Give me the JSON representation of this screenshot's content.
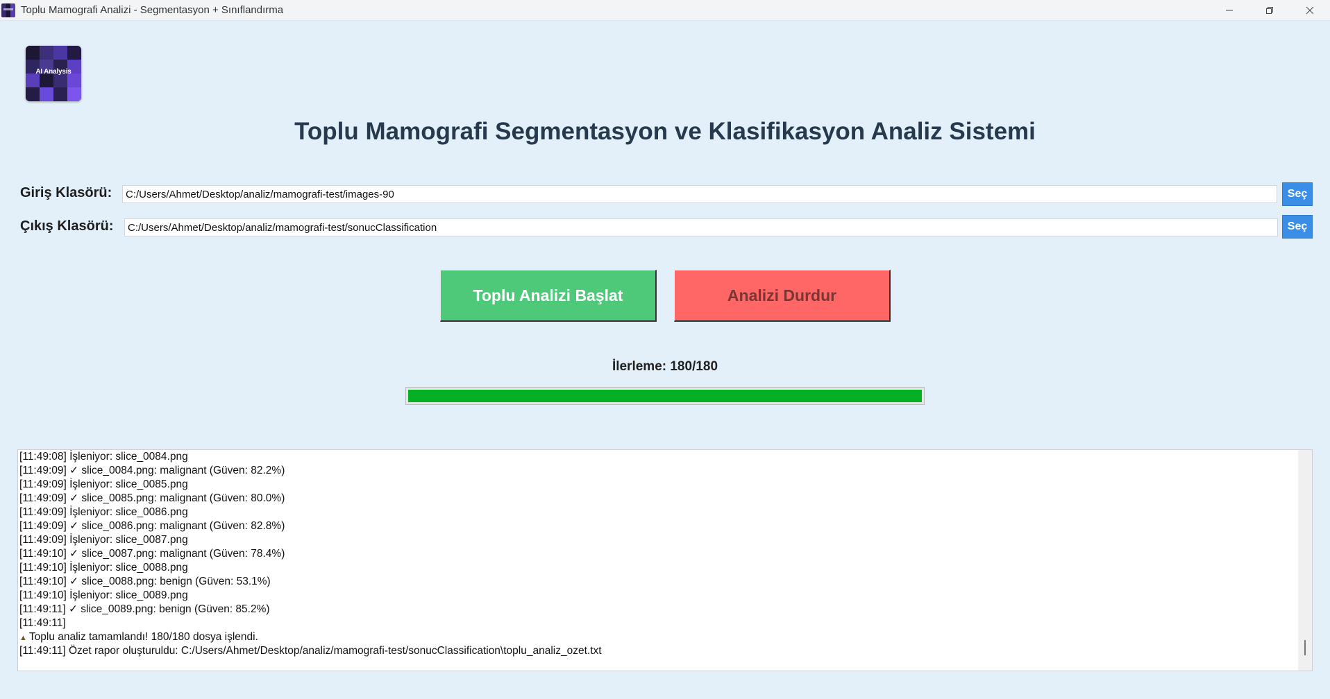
{
  "window": {
    "title": "Toplu Mamografi Analizi - Segmentasyon + Sınıflandırma"
  },
  "logo": {
    "text": "AI Analysis"
  },
  "heading": "Toplu Mamografi Segmentasyon ve Klasifikasyon Analiz Sistemi",
  "input_folder": {
    "label": "Giriş Klasörü:",
    "value": "C:/Users/Ahmet/Desktop/analiz/mamografi-test/images-90",
    "button": "Seç"
  },
  "output_folder": {
    "label": "Çıkış Klasörü:",
    "value": "C:/Users/Ahmet/Desktop/analiz/mamografi-test/sonucClassification",
    "button": "Seç"
  },
  "actions": {
    "start": "Toplu Analizi Başlat",
    "stop": "Analizi Durdur"
  },
  "progress": {
    "label": "İlerleme: 180/180",
    "fraction": 1.0
  },
  "log": {
    "lines": [
      "[11:49:08] İşleniyor: slice_0084.png",
      "[11:49:09] ✓ slice_0084.png: malignant (Güven: 82.2%)",
      "[11:49:09] İşleniyor: slice_0085.png",
      "[11:49:09] ✓ slice_0085.png: malignant (Güven: 80.0%)",
      "[11:49:09] İşleniyor: slice_0086.png",
      "[11:49:09] ✓ slice_0086.png: malignant (Güven: 82.8%)",
      "[11:49:09] İşleniyor: slice_0087.png",
      "[11:49:10] ✓ slice_0087.png: malignant (Güven: 78.4%)",
      "[11:49:10] İşleniyor: slice_0088.png",
      "[11:49:10] ✓ slice_0088.png: benign (Güven: 53.1%)",
      "[11:49:10] İşleniyor: slice_0089.png",
      "[11:49:11] ✓ slice_0089.png: benign (Güven: 85.2%)",
      "[11:49:11]",
      "Toplu analiz tamamlandı! 180/180 dosya işlendi.",
      "[11:49:11] Özet rapor oluşturuldu: C:/Users/Ahmet/Desktop/analiz/mamografi-test/sonucClassification\\toplu_analiz_ozet.txt"
    ]
  },
  "colors": {
    "background": "#e3f0f9",
    "start_button": "#4ec97a",
    "stop_button": "#ff6666",
    "select_button": "#3a8ee6",
    "progress_fill": "#06b025"
  }
}
